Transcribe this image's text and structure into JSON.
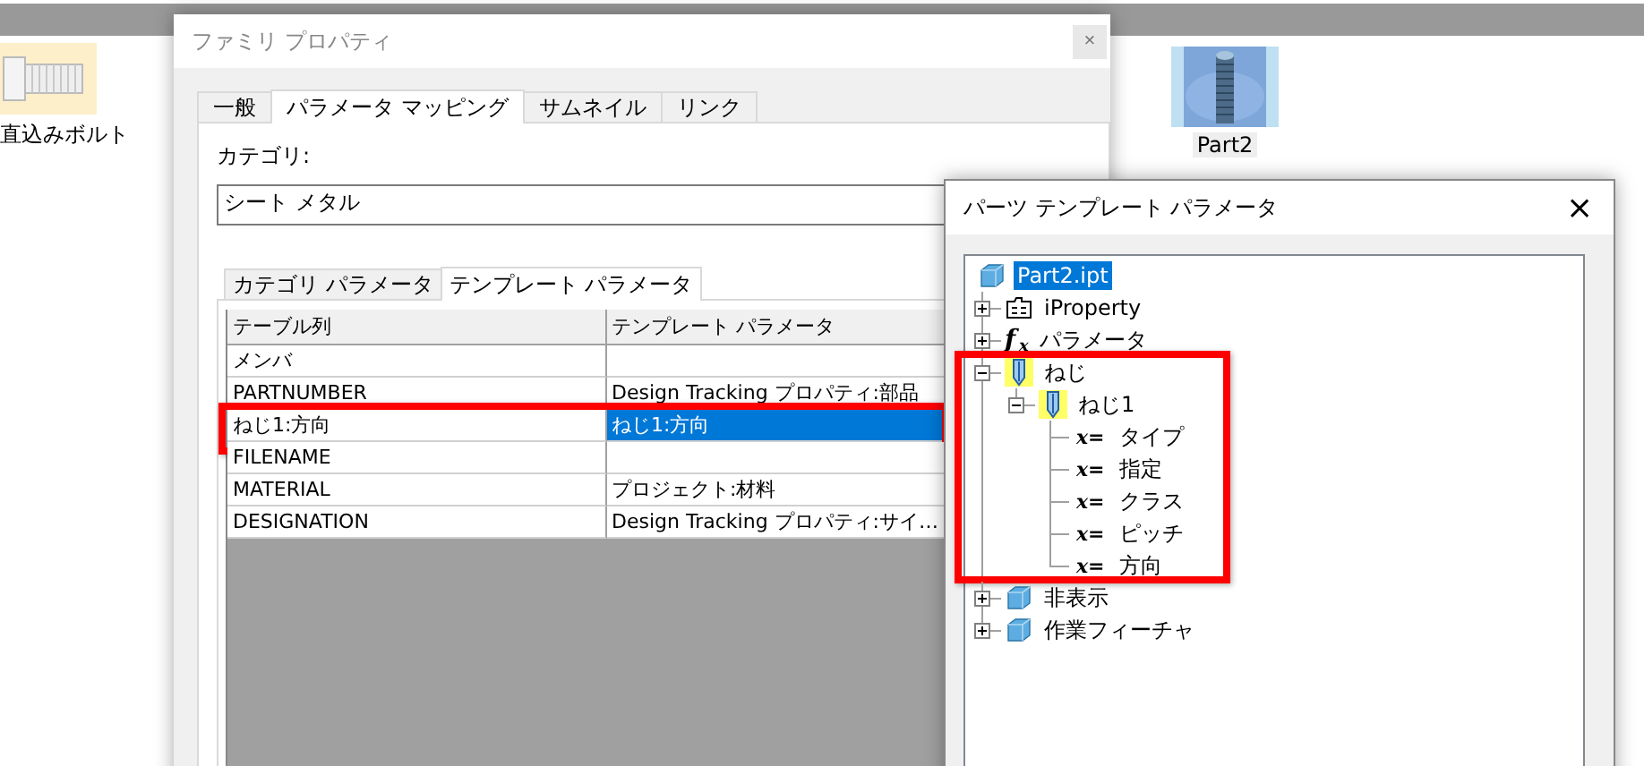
{
  "desktop": {
    "icons": [
      {
        "label": "直込みボルト",
        "kind": "bolt",
        "selected": false
      },
      {
        "label": "Part2",
        "kind": "part",
        "selected": true
      }
    ]
  },
  "family_dialog": {
    "title": "ファミリ プロパティ",
    "close": "×",
    "tabs": [
      {
        "label": "一般",
        "selected": false
      },
      {
        "label": "パラメータ マッピング",
        "selected": true
      },
      {
        "label": "サムネイル",
        "selected": false
      },
      {
        "label": "リンク",
        "selected": false
      }
    ],
    "category_label": "カテゴリ:",
    "category_value": "シート メタル",
    "subtabs": [
      {
        "label": "カテゴリ パラメータ",
        "selected": false
      },
      {
        "label": "テンプレート パラメータ",
        "selected": true
      }
    ],
    "table": {
      "columns": [
        "テーブル列",
        "テンプレート パラメータ"
      ],
      "rows": [
        {
          "column": "メンバ",
          "selected": false,
          "highlighted": false
        },
        {
          "column": "PARTNUMBER",
          "parameter": "Design Tracking プロパティ:部品",
          "selected": false,
          "highlighted": false
        },
        {
          "column": "ねじ1:方向",
          "parameter": "ねじ1:方向",
          "selected": true,
          "highlighted": true
        },
        {
          "column": "FILENAME",
          "selected": false,
          "highlighted": false
        },
        {
          "column": "MATERIAL",
          "parameter": "プロジェクト:材料",
          "selected": false,
          "highlighted": false
        },
        {
          "column": "DESIGNATION",
          "parameter": "Design Tracking プロパティ:サイ…",
          "selected": false,
          "highlighted": false
        }
      ]
    }
  },
  "parts_dialog": {
    "title": "パーツ テンプレート パラメータ",
    "close": "×",
    "tree": [
      {
        "label": "Part2.ipt",
        "kind": "part",
        "selected": true,
        "children": [
          {
            "label": "iProperty",
            "kind": "iproperty",
            "selected": false,
            "expanded": false,
            "highlighted": false
          },
          {
            "label": "パラメータ",
            "kind": "parameters",
            "symbol": "f$_{x}$",
            "selected": false,
            "expanded": false,
            "highlighted": false
          },
          {
            "label": "ねじ",
            "kind": "thread",
            "selected": false,
            "expanded": true,
            "highlighted": true,
            "children": [
              {
                "label": "ねじ1",
                "kind": "thread",
                "selected": false,
                "expanded": true,
                "highlighted": false,
                "children": [
                  {
                    "label": "タイプ",
                    "kind": "parameter",
                    "symbol": "x=",
                    "selected": false
                  },
                  {
                    "label": "指定",
                    "kind": "parameter",
                    "symbol": "x=",
                    "selected": false
                  },
                  {
                    "label": "クラス",
                    "kind": "parameter",
                    "symbol": "x=",
                    "selected": false
                  },
                  {
                    "label": "ピッチ",
                    "kind": "parameter",
                    "symbol": "x=",
                    "selected": false
                  },
                  {
                    "label": "方向",
                    "kind": "parameter",
                    "symbol": "x=",
                    "selected": false
                  }
                ]
              }
            ]
          },
          {
            "label": "非表示",
            "kind": "folder",
            "selected": false,
            "expanded": false,
            "highlighted": false
          },
          {
            "label": "作業フィーチャ",
            "kind": "folder",
            "selected": false,
            "expanded": false,
            "highlighted": false
          }
        ]
      }
    ]
  }
}
